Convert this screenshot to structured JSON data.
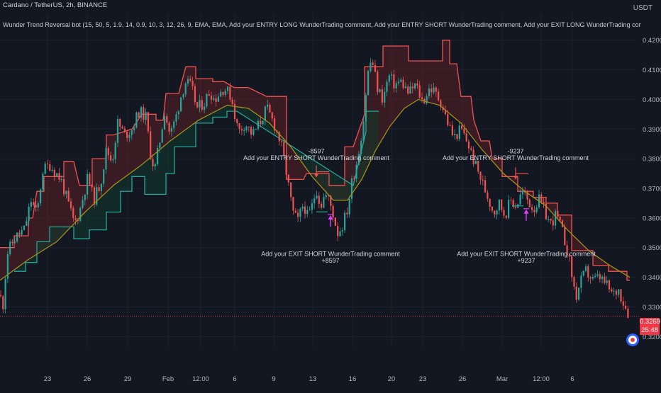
{
  "header": {
    "title": "Cardano / TetherUS, 2h, BINANCE",
    "indicator": "Wunder Trend Reversal bot (15, 50, 5, 1.9, 14, 0.9, 10, 3, 12, 26, 9, EMA, EMA, Add your ENTRY LONG WunderTrading comment, Add your ENTRY SHORT WunderTrading comment, Add your EXIT LONG WunderTrading comment, Add your EXIT SHORT WunderTrading comment)",
    "currency": "USDT"
  },
  "last_price": "0.3269",
  "countdown": "25:48",
  "colors": {
    "background": "#131722",
    "grid": "#1e2230",
    "up": "#26a69a",
    "down": "#ef5350",
    "ma": "#a08f1e",
    "stop_fill_red": "#5a1f25",
    "stop_fill_green": "#103a2c",
    "signal": "#e040fb",
    "price_badge": "#f23645"
  },
  "chart_data": {
    "type": "candlestick",
    "y_ticks": [
      "0.4200",
      "0.4100",
      "0.4000",
      "0.3900",
      "0.3800",
      "0.3700",
      "0.3600",
      "0.3500",
      "0.3400",
      "0.3300",
      "0.3200"
    ],
    "x_ticks": [
      "23",
      "26",
      "29",
      "Feb",
      "12:00",
      "6",
      "9",
      "13",
      "16",
      "20",
      "23",
      "26",
      "Mar",
      "12:00",
      "6"
    ],
    "ylim": [
      0.3165,
      0.4235
    ],
    "grid": true,
    "close_path": [
      [
        0,
        0.334
      ],
      [
        4,
        0.33
      ],
      [
        10,
        0.348
      ],
      [
        20,
        0.353
      ],
      [
        34,
        0.356
      ],
      [
        44,
        0.366
      ],
      [
        52,
        0.361
      ],
      [
        60,
        0.376
      ],
      [
        70,
        0.378
      ],
      [
        86,
        0.373
      ],
      [
        96,
        0.365
      ],
      [
        105,
        0.358
      ],
      [
        112,
        0.362
      ],
      [
        124,
        0.374
      ],
      [
        132,
        0.366
      ],
      [
        142,
        0.372
      ],
      [
        150,
        0.383
      ],
      [
        158,
        0.379
      ],
      [
        166,
        0.392
      ],
      [
        176,
        0.388
      ],
      [
        186,
        0.39
      ],
      [
        196,
        0.396
      ],
      [
        206,
        0.394
      ],
      [
        212,
        0.382
      ],
      [
        218,
        0.376
      ],
      [
        226,
        0.387
      ],
      [
        232,
        0.396
      ],
      [
        240,
        0.388
      ],
      [
        248,
        0.394
      ],
      [
        256,
        0.402
      ],
      [
        262,
        0.406
      ],
      [
        270,
        0.404
      ],
      [
        278,
        0.397
      ],
      [
        288,
        0.399
      ],
      [
        296,
        0.403
      ],
      [
        302,
        0.4
      ],
      [
        316,
        0.404
      ],
      [
        326,
        0.401
      ],
      [
        336,
        0.389
      ],
      [
        346,
        0.392
      ],
      [
        356,
        0.388
      ],
      [
        366,
        0.392
      ],
      [
        376,
        0.397
      ],
      [
        386,
        0.392
      ],
      [
        396,
        0.385
      ],
      [
        404,
        0.375
      ],
      [
        410,
        0.366
      ],
      [
        414,
        0.361
      ],
      [
        420,
        0.359
      ],
      [
        428,
        0.365
      ],
      [
        434,
        0.36
      ],
      [
        440,
        0.364
      ],
      [
        446,
        0.37
      ],
      [
        452,
        0.364
      ],
      [
        458,
        0.368
      ],
      [
        464,
        0.366
      ],
      [
        470,
        0.361
      ],
      [
        476,
        0.355
      ],
      [
        482,
        0.357
      ],
      [
        490,
        0.363
      ],
      [
        496,
        0.372
      ],
      [
        504,
        0.38
      ],
      [
        512,
        0.392
      ],
      [
        518,
        0.408
      ],
      [
        524,
        0.414
      ],
      [
        532,
        0.404
      ],
      [
        540,
        0.4
      ],
      [
        548,
        0.408
      ],
      [
        556,
        0.405
      ],
      [
        566,
        0.406
      ],
      [
        576,
        0.402
      ],
      [
        586,
        0.405
      ],
      [
        596,
        0.399
      ],
      [
        606,
        0.404
      ],
      [
        614,
        0.402
      ],
      [
        622,
        0.399
      ],
      [
        630,
        0.393
      ],
      [
        640,
        0.387
      ],
      [
        650,
        0.39
      ],
      [
        660,
        0.385
      ],
      [
        670,
        0.378
      ],
      [
        680,
        0.372
      ],
      [
        688,
        0.367
      ],
      [
        696,
        0.362
      ],
      [
        704,
        0.365
      ],
      [
        712,
        0.361
      ],
      [
        720,
        0.366
      ],
      [
        728,
        0.364
      ],
      [
        736,
        0.369
      ],
      [
        744,
        0.366
      ],
      [
        752,
        0.363
      ],
      [
        760,
        0.366
      ],
      [
        768,
        0.362
      ],
      [
        776,
        0.358
      ],
      [
        784,
        0.361
      ],
      [
        792,
        0.356
      ],
      [
        800,
        0.349
      ],
      [
        806,
        0.341
      ],
      [
        812,
        0.333
      ],
      [
        818,
        0.338
      ],
      [
        826,
        0.342
      ],
      [
        836,
        0.339
      ],
      [
        846,
        0.34
      ],
      [
        856,
        0.337
      ],
      [
        864,
        0.334
      ],
      [
        872,
        0.336
      ],
      [
        880,
        0.331
      ],
      [
        888,
        0.3269
      ]
    ],
    "ma_path": [
      [
        0,
        0.339
      ],
      [
        40,
        0.346
      ],
      [
        80,
        0.352
      ],
      [
        120,
        0.362
      ],
      [
        160,
        0.371
      ],
      [
        200,
        0.378
      ],
      [
        240,
        0.386
      ],
      [
        280,
        0.393
      ],
      [
        320,
        0.398
      ],
      [
        350,
        0.397
      ],
      [
        380,
        0.392
      ],
      [
        410,
        0.384
      ],
      [
        440,
        0.374
      ],
      [
        470,
        0.366
      ],
      [
        490,
        0.366
      ],
      [
        510,
        0.373
      ],
      [
        530,
        0.383
      ],
      [
        550,
        0.391
      ],
      [
        570,
        0.397
      ],
      [
        590,
        0.4
      ],
      [
        620,
        0.398
      ],
      [
        650,
        0.392
      ],
      [
        680,
        0.383
      ],
      [
        710,
        0.375
      ],
      [
        740,
        0.369
      ],
      [
        770,
        0.364
      ],
      [
        800,
        0.356
      ],
      [
        830,
        0.349
      ],
      [
        860,
        0.344
      ],
      [
        888,
        0.34
      ]
    ],
    "red_stop": [
      [
        0,
        0.35
      ],
      [
        20,
        0.35
      ],
      [
        20,
        0.354
      ],
      [
        40,
        0.354
      ],
      [
        40,
        0.36
      ],
      [
        46,
        0.36
      ],
      [
        52,
        0.369
      ],
      [
        62,
        0.369
      ],
      [
        62,
        0.374
      ],
      [
        90,
        0.374
      ],
      [
        90,
        0.379
      ],
      [
        104,
        0.379
      ],
      [
        112,
        0.371
      ],
      [
        130,
        0.371
      ],
      [
        130,
        0.38
      ],
      [
        150,
        0.38
      ],
      [
        150,
        0.388
      ],
      [
        160,
        0.388
      ],
      [
        186,
        0.39
      ],
      [
        200,
        0.395
      ],
      [
        220,
        0.395
      ],
      [
        220,
        0.393
      ],
      [
        230,
        0.393
      ],
      [
        234,
        0.402
      ],
      [
        252,
        0.402
      ],
      [
        262,
        0.411
      ],
      [
        276,
        0.411
      ],
      [
        276,
        0.407
      ],
      [
        300,
        0.407
      ],
      [
        300,
        0.406
      ],
      [
        316,
        0.406
      ],
      [
        330,
        0.404
      ],
      [
        350,
        0.404
      ],
      [
        376,
        0.401
      ],
      [
        404,
        0.401
      ],
      [
        404,
        0.373
      ],
      [
        428,
        0.373
      ],
      [
        432,
        0.375
      ],
      [
        464,
        0.375
      ],
      [
        464,
        0.371
      ],
      [
        486,
        0.371
      ],
      [
        486,
        0.384
      ],
      [
        498,
        0.384
      ],
      [
        514,
        0.395
      ],
      [
        514,
        0.411
      ],
      [
        540,
        0.411
      ],
      [
        540,
        0.418
      ],
      [
        576,
        0.418
      ],
      [
        576,
        0.413
      ],
      [
        624,
        0.413
      ],
      [
        624,
        0.42
      ],
      [
        634,
        0.42
      ],
      [
        634,
        0.412
      ],
      [
        644,
        0.412
      ],
      [
        650,
        0.401
      ],
      [
        664,
        0.401
      ],
      [
        668,
        0.393
      ],
      [
        678,
        0.386
      ],
      [
        690,
        0.386
      ],
      [
        694,
        0.38
      ],
      [
        708,
        0.38
      ],
      [
        708,
        0.374
      ],
      [
        720,
        0.374
      ],
      [
        730,
        0.374
      ],
      [
        730,
        0.369
      ],
      [
        752,
        0.369
      ],
      [
        752,
        0.367
      ],
      [
        770,
        0.367
      ],
      [
        770,
        0.365
      ],
      [
        786,
        0.365
      ],
      [
        786,
        0.361
      ],
      [
        806,
        0.361
      ],
      [
        806,
        0.349
      ],
      [
        836,
        0.349
      ],
      [
        836,
        0.344
      ],
      [
        858,
        0.344
      ],
      [
        858,
        0.342
      ],
      [
        884,
        0.342
      ],
      [
        884,
        0.339
      ],
      [
        888,
        0.339
      ]
    ],
    "green_stop": [
      [
        20,
        0.342
      ],
      [
        36,
        0.342
      ],
      [
        36,
        0.345
      ],
      [
        52,
        0.345
      ],
      [
        52,
        0.352
      ],
      [
        70,
        0.352
      ],
      [
        70,
        0.357
      ],
      [
        104,
        0.357
      ],
      [
        104,
        0.353
      ],
      [
        126,
        0.353
      ],
      [
        126,
        0.356
      ],
      [
        150,
        0.356
      ],
      [
        150,
        0.362
      ],
      [
        170,
        0.362
      ],
      [
        170,
        0.369
      ],
      [
        186,
        0.369
      ],
      [
        186,
        0.374
      ],
      [
        204,
        0.374
      ],
      [
        204,
        0.368
      ],
      [
        234,
        0.368
      ],
      [
        234,
        0.375
      ],
      [
        246,
        0.375
      ],
      [
        246,
        0.384
      ],
      [
        276,
        0.384
      ],
      [
        276,
        0.392
      ],
      [
        300,
        0.392
      ],
      [
        300,
        0.394
      ],
      [
        320,
        0.394
      ],
      [
        320,
        0.396
      ],
      [
        334,
        0.396
      ],
      [
        498,
        0.371
      ],
      [
        516,
        0.389
      ],
      [
        516,
        0.396
      ],
      [
        534,
        0.396
      ]
    ],
    "annotations": [
      {
        "text": "-8597",
        "x": 446,
        "y": 0.3818
      },
      {
        "text": "Add your ENTRY SHORT WunderTrading comment",
        "x": 446,
        "y": 0.3795
      },
      {
        "text": "Add your EXIT SHORT WunderTrading comment",
        "x": 466,
        "y": 0.3472
      },
      {
        "text": "+8597",
        "x": 466,
        "y": 0.3449
      },
      {
        "text": "-9237",
        "x": 727,
        "y": 0.3818
      },
      {
        "text": "Add your ENTRY SHORT WunderTrading comment",
        "x": 727,
        "y": 0.3795
      },
      {
        "text": "Add your EXIT SHORT WunderTrading comment",
        "x": 742,
        "y": 0.3472
      },
      {
        "text": "+9237",
        "x": 742,
        "y": 0.3449
      }
    ],
    "signals": [
      {
        "kind": "entry",
        "x": 446,
        "y": 0.3749
      },
      {
        "kind": "exit",
        "x": 466,
        "y": 0.3585
      },
      {
        "kind": "entry",
        "x": 727,
        "y": 0.3742
      },
      {
        "kind": "exit",
        "x": 742,
        "y": 0.3605
      }
    ]
  }
}
